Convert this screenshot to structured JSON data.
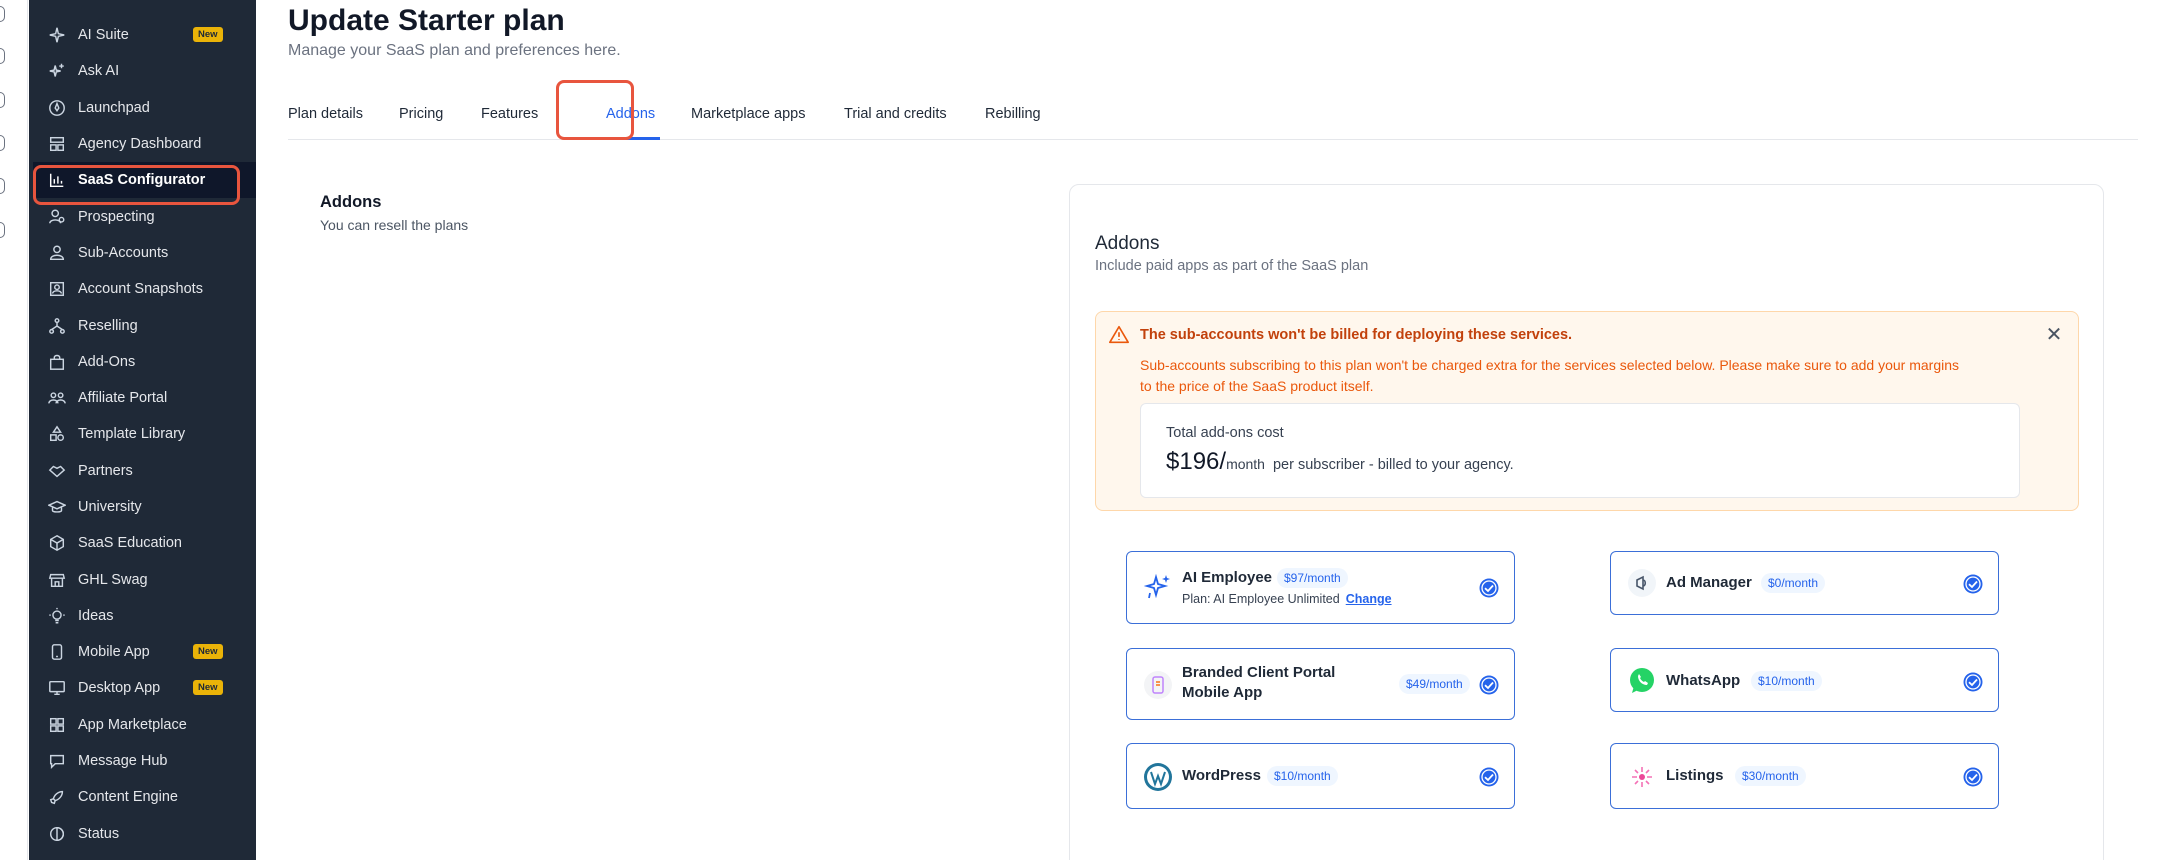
{
  "sidebar": {
    "items": [
      {
        "label": "AI Suite",
        "icon": "sparkles-icon",
        "badge": "New"
      },
      {
        "label": "Ask AI",
        "icon": "sparkle-plus-icon"
      },
      {
        "label": "Launchpad",
        "icon": "rocket-circle-icon"
      },
      {
        "label": "Agency Dashboard",
        "icon": "dashboard-icon"
      },
      {
        "label": "SaaS Configurator",
        "icon": "chart-icon",
        "active": true
      },
      {
        "label": "Prospecting",
        "icon": "user-search-icon"
      },
      {
        "label": "Sub-Accounts",
        "icon": "user-icon"
      },
      {
        "label": "Account Snapshots",
        "icon": "snapshot-icon"
      },
      {
        "label": "Reselling",
        "icon": "network-icon"
      },
      {
        "label": "Add-Ons",
        "icon": "bag-icon"
      },
      {
        "label": "Affiliate Portal",
        "icon": "users-icon"
      },
      {
        "label": "Template Library",
        "icon": "shapes-icon"
      },
      {
        "label": "Partners",
        "icon": "handshake-icon"
      },
      {
        "label": "University",
        "icon": "graduation-cap-icon"
      },
      {
        "label": "SaaS Education",
        "icon": "cube-icon"
      },
      {
        "label": "GHL Swag",
        "icon": "store-icon"
      },
      {
        "label": "Ideas",
        "icon": "lightbulb-icon"
      },
      {
        "label": "Mobile App",
        "icon": "mobile-icon",
        "badge": "New"
      },
      {
        "label": "Desktop App",
        "icon": "desktop-icon",
        "badge": "New"
      },
      {
        "label": "App Marketplace",
        "icon": "grid-icon"
      },
      {
        "label": "Message Hub",
        "icon": "chat-icon"
      },
      {
        "label": "Content Engine",
        "icon": "rocket-icon"
      },
      {
        "label": "Status",
        "icon": "status-icon"
      }
    ]
  },
  "header": {
    "title": "Update Starter plan",
    "subtitle": "Manage your SaaS plan and preferences here."
  },
  "tabs": [
    {
      "label": "Plan details"
    },
    {
      "label": "Pricing"
    },
    {
      "label": "Features"
    },
    {
      "label": "Addons",
      "active": true
    },
    {
      "label": "Marketplace apps"
    },
    {
      "label": "Trial and credits"
    },
    {
      "label": "Rebilling"
    }
  ],
  "section": {
    "title": "Addons",
    "description": "You can resell the plans"
  },
  "card": {
    "title": "Addons",
    "subtitle": "Include paid apps as part of the SaaS plan",
    "alert": {
      "title": "The sub-accounts won't be billed for deploying these services.",
      "body": "Sub-accounts subscribing to this plan won't be charged extra for the services selected below. Please make sure to add your margins to the price of the SaaS product itself.",
      "cost_label": "Total add-ons cost",
      "cost_amount": "$196/",
      "cost_unit": "month",
      "cost_note": "per subscriber - billed to your agency."
    },
    "addons": [
      {
        "name": "AI Employee",
        "price": "$97/month",
        "plan_label": "Plan: AI Employee Unlimited",
        "plan_action": "Change",
        "icon": "ai-sparkles-icon",
        "checked": true
      },
      {
        "name": "Ad Manager",
        "price": "$0/month",
        "icon": "ad-manager-icon",
        "checked": true
      },
      {
        "name": "Branded Client Portal Mobile App",
        "price": "$49/month",
        "icon": "mobile-app-icon",
        "checked": true
      },
      {
        "name": "WhatsApp",
        "price": "$10/month",
        "icon": "whatsapp-icon",
        "checked": true
      },
      {
        "name": "WordPress",
        "price": "$10/month",
        "icon": "wordpress-icon",
        "checked": true
      },
      {
        "name": "Listings",
        "price": "$30/month",
        "icon": "listings-icon",
        "checked": true
      }
    ]
  },
  "colors": {
    "accent": "#2563eb",
    "highlight_ring": "#e8553e",
    "sidebar_bg": "#1f2937",
    "badge_bg": "#eab308",
    "alert_bg": "#fff7ed",
    "alert_text": "#ea580c"
  }
}
